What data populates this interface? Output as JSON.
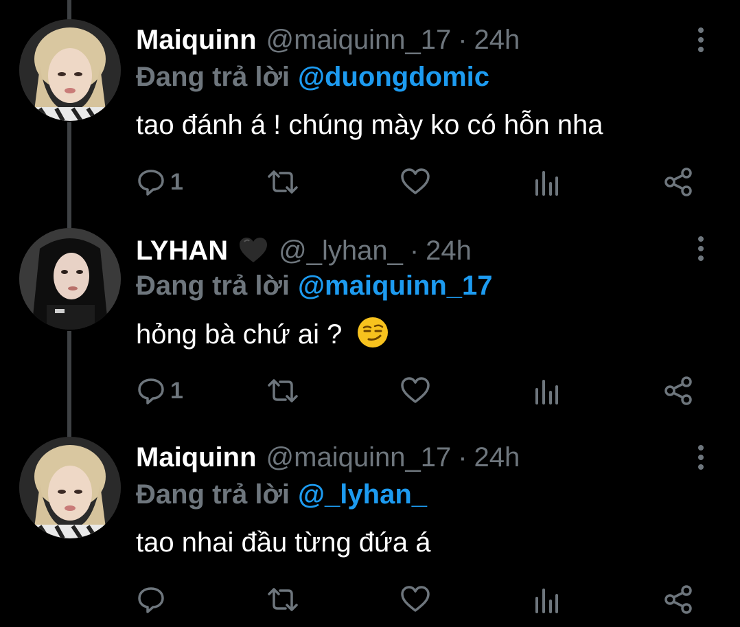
{
  "colors": {
    "background": "#000000",
    "name": "#ffffff",
    "secondary": "#6e767d",
    "mention": "#1d9bf0",
    "thread_line": "#3e4144"
  },
  "tweets": [
    {
      "display_name": "Maiquinn",
      "badge_emoji": "",
      "handle": "@maiquinn_17",
      "separator": "·",
      "time": "24h",
      "reply_prefix": "Đang trả lời",
      "reply_to": "@duongdomic",
      "text": "tao đánh á ! chúng mày ko có hỗn nha",
      "text_emoji": "",
      "reply_count": "1",
      "avatar_icon": "avatar-blonde"
    },
    {
      "display_name": "LYHAN",
      "badge_emoji": "black-heart-icon",
      "handle": "@_lyhan_",
      "separator": "·",
      "time": "24h",
      "reply_prefix": "Đang trả lời",
      "reply_to": "@maiquinn_17",
      "text": "hỏng bà chứ ai ?",
      "text_emoji": "smirking-face-icon",
      "reply_count": "1",
      "avatar_icon": "avatar-dark-hair"
    },
    {
      "display_name": "Maiquinn",
      "badge_emoji": "",
      "handle": "@maiquinn_17",
      "separator": "·",
      "time": "24h",
      "reply_prefix": "Đang trả lời",
      "reply_to": "@_lyhan_",
      "text": "tao nhai đầu từng đứa á",
      "text_emoji": "",
      "reply_count": "",
      "avatar_icon": "avatar-blonde"
    }
  ]
}
